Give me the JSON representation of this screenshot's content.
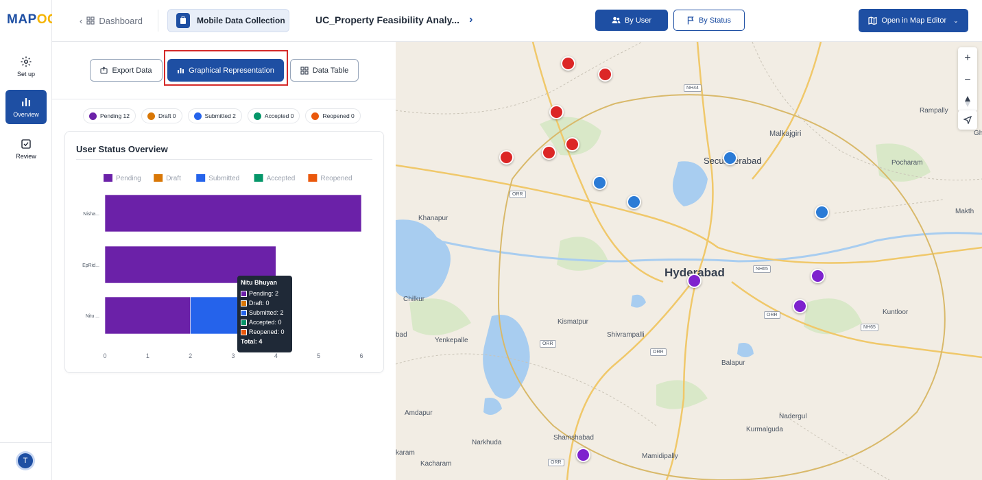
{
  "logo": {
    "main": "MAP",
    "accent": "OG"
  },
  "sidebar": {
    "items": [
      {
        "label": "Set up",
        "icon": "gear-icon"
      },
      {
        "label": "Overview",
        "icon": "bar-chart-icon"
      },
      {
        "label": "Review",
        "icon": "checkbox-icon"
      }
    ],
    "avatar_initial": "T"
  },
  "header": {
    "dashboard": "Dashboard",
    "collection": "Mobile Data Collection",
    "project": "UC_Property Feasibility Analy...",
    "by_user": "By User",
    "by_status": "By Status",
    "open_editor": "Open in Map Editor"
  },
  "tabs": {
    "export": "Export Data",
    "graph": "Graphical Representation",
    "table": "Data Table"
  },
  "chips": [
    {
      "label": "Pending 12",
      "color": "#6b21a8"
    },
    {
      "label": "Draft 0",
      "color": "#d97706"
    },
    {
      "label": "Submitted 2",
      "color": "#2563eb"
    },
    {
      "label": "Accepted 0",
      "color": "#059669"
    },
    {
      "label": "Reopened 0",
      "color": "#ea580c"
    }
  ],
  "card": {
    "title": "User Status Overview"
  },
  "colors": {
    "Pending": "#6b21a8",
    "Draft": "#d97706",
    "Submitted": "#2563eb",
    "Accepted": "#059669",
    "Reopened": "#ea580c"
  },
  "chart_data": {
    "type": "bar",
    "orientation": "horizontal",
    "stacked": true,
    "categories": [
      "Nisha...",
      "EpRid...",
      "Nitu ..."
    ],
    "series": [
      {
        "name": "Pending",
        "values": [
          6,
          4,
          2
        ]
      },
      {
        "name": "Draft",
        "values": [
          0,
          0,
          0
        ]
      },
      {
        "name": "Submitted",
        "values": [
          0,
          0,
          2
        ]
      },
      {
        "name": "Accepted",
        "values": [
          0,
          0,
          0
        ]
      },
      {
        "name": "Reopened",
        "values": [
          0,
          0,
          0
        ]
      }
    ],
    "xlim": [
      0,
      6
    ],
    "xticks": [
      0,
      1,
      2,
      3,
      4,
      5,
      6
    ],
    "legend": "top",
    "grid": false
  },
  "tooltip": {
    "title": "Nitu Bhuyan",
    "rows": [
      "Pending: 2",
      "Draft: 0",
      "Submitted: 2",
      "Accepted: 0",
      "Reopened: 0"
    ],
    "total": "Total: 4"
  },
  "map": {
    "labels": {
      "hyderabad": "Hyderabad",
      "secunderabad": "Secunderabad",
      "malkajgiri": "Malkajgiri",
      "khanapur": "Khanapur",
      "chilkur": "Chilkur",
      "kismatpur": "Kismatpur",
      "shivrampalli": "Shivrampalli",
      "yenkepalle": "Yenkepalle",
      "bad": "bad",
      "balapur": "Balapur",
      "amdapur": "Amdapur",
      "narkhuda": "Narkhuda",
      "shamshabad": "Shamshabad",
      "kacharam": "Kacharam",
      "karam": "karam",
      "mamidipally": "Mamidipally",
      "kurmalguda": "Kurmalguda",
      "nadergul": "Nadergul",
      "kuntloor": "Kuntloor",
      "pocharam": "Pocharam",
      "rampally": "Rampally",
      "makth": "Makth",
      "gh": "Gh"
    },
    "shields": [
      "ORR",
      "NH44",
      "NH65",
      "NH65",
      "ORR",
      "ORR",
      "ORR",
      "ORR"
    ],
    "controls": {
      "zoom_in": "+",
      "zoom_out": "−"
    }
  }
}
